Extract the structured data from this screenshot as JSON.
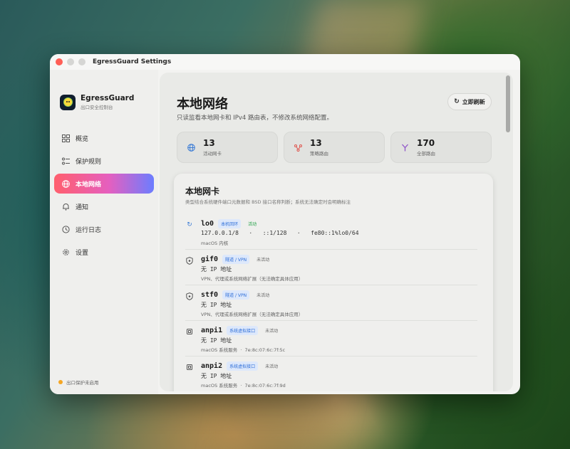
{
  "window": {
    "title": "EgressGuard Settings"
  },
  "brand": {
    "name": "EgressGuard",
    "subtitle": "出口安全控制台"
  },
  "nav": {
    "items": [
      {
        "label": "概览",
        "icon": "grid-icon"
      },
      {
        "label": "保护规则",
        "icon": "rules-icon"
      },
      {
        "label": "本地网络",
        "icon": "globe-icon",
        "active": true
      },
      {
        "label": "通知",
        "icon": "bell-icon"
      },
      {
        "label": "运行日志",
        "icon": "clock-icon"
      },
      {
        "label": "设置",
        "icon": "gear-icon"
      }
    ]
  },
  "status": {
    "text": "出口保护未启用",
    "color": "#f5a623"
  },
  "header": {
    "title": "本地网络",
    "subtitle": "只读监看本地网卡和 IPv4 路由表，不修改系统网络配置。",
    "refresh_label": "立即刷新"
  },
  "stats": [
    {
      "value": "13",
      "label": "活动网卡",
      "icon": "globe-icon",
      "color": "#3a7bd5"
    },
    {
      "value": "13",
      "label": "策略路由",
      "icon": "route-icon",
      "color": "#e0554e"
    },
    {
      "value": "170",
      "label": "全部路由",
      "icon": "branch-icon",
      "color": "#8e54c9"
    }
  ],
  "card": {
    "title": "本地网卡",
    "subtitle": "类型结合系统硬件端口元数据和 BSD 接口名称判断；系统无法确定时会明确标注",
    "interfaces": [
      {
        "name": "lo0",
        "badge": "本机回环",
        "state": "活动",
        "state_active": true,
        "addresses": "127.0.0.1/8   ·   ::1/128   ·   fe80::1%lo0/64",
        "detail": "macOS 内核",
        "icon": "refresh-icon"
      },
      {
        "name": "gif0",
        "badge": "隧道 / VPN",
        "state": "未活动",
        "state_active": false,
        "addresses": "无 IP 地址",
        "detail": "VPN、代理或系统网络扩展（无法确定具体应用）",
        "icon": "shield-icon"
      },
      {
        "name": "stf0",
        "badge": "隧道 / VPN",
        "state": "未活动",
        "state_active": false,
        "addresses": "无 IP 地址",
        "detail": "VPN、代理或系统网络扩展（无法确定具体应用）",
        "icon": "shield-icon"
      },
      {
        "name": "anpi1",
        "badge": "系统虚拟接口",
        "state": "未活动",
        "state_active": false,
        "addresses": "无 IP 地址",
        "detail": "macOS 系统服务  ·  7e:8c:07:6c:7f:5c",
        "icon": "chip-icon"
      },
      {
        "name": "anpi2",
        "badge": "系统虚拟接口",
        "state": "未活动",
        "state_active": false,
        "addresses": "无 IP 地址",
        "detail": "macOS 系统服务  ·  7e:8c:07:6c:7f:9d",
        "icon": "chip-icon"
      }
    ]
  }
}
